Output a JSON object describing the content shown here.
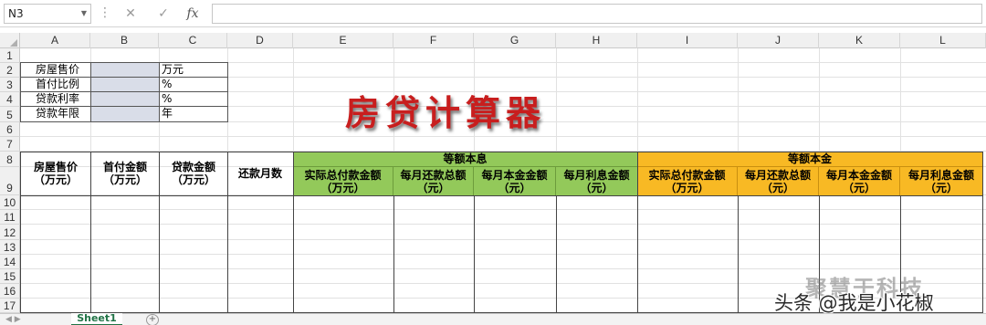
{
  "formula_bar": {
    "name_box": "N3",
    "cancel_icon": "✕",
    "enter_icon": "✓",
    "fx_label": "fx",
    "formula": ""
  },
  "columns": [
    "A",
    "B",
    "C",
    "D",
    "E",
    "F",
    "G",
    "H",
    "I",
    "J",
    "K",
    "L"
  ],
  "rows": [
    "1",
    "2",
    "3",
    "4",
    "5",
    "6",
    "7",
    "8",
    "9",
    "10",
    "11",
    "12",
    "13",
    "14",
    "15",
    "16",
    "17"
  ],
  "inputs": {
    "labels": [
      "房屋售价",
      "首付比例",
      "贷款利率",
      "贷款年限"
    ],
    "values": [
      "",
      "",
      "",
      ""
    ],
    "units": [
      "万元",
      "%",
      "%",
      "年"
    ]
  },
  "title": "房贷计算器",
  "table": {
    "headers": {
      "a": "房屋售价\n（万元）",
      "b": "首付金额\n（万元）",
      "c": "贷款金额\n（万元）",
      "d": "还款月数"
    },
    "group_equal_interest": {
      "title": "等额本息",
      "cols": [
        "实际总付款金额\n（万元）",
        "每月还款总额\n（元）",
        "每月本金金额\n（元）",
        "每月利息金额\n（元）"
      ]
    },
    "group_equal_principal": {
      "title": "等额本金",
      "cols": [
        "实际总付款金额\n（万元）",
        "每月还款总额\n（元）",
        "每月本金金额\n（元）",
        "每月利息金额\n（元）"
      ]
    }
  },
  "sheet_tabs": [
    "Sheet1"
  ],
  "watermark": {
    "icon": "头条",
    "text": "头条 @我是小花椒",
    "logo": "聚慧于科技"
  },
  "colors": {
    "green": "#93c95a",
    "orange": "#f8b924",
    "title_red": "#c81e1e",
    "input_fill": "#d9dde8"
  }
}
